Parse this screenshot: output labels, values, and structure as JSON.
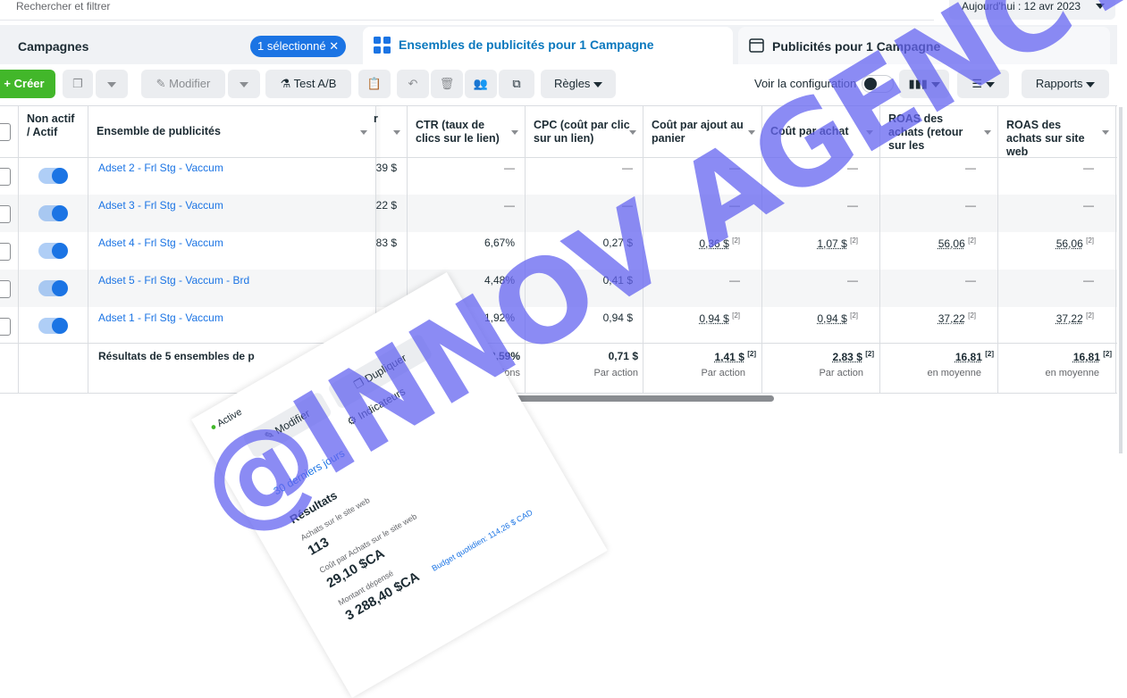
{
  "search": {
    "placeholder": "Rechercher et filtrer"
  },
  "date_range": "Aujourd'hui : 12 avr 2023",
  "tabs": {
    "campaigns": "Campagnes",
    "selected_badge": "1 sélectionné",
    "adsets": "Ensembles de publicités pour 1 Campagne",
    "ads": "Publicités pour 1 Campagne"
  },
  "toolbar": {
    "create": "Créer",
    "edit": "Modifier",
    "ab_test": "Test A/B",
    "rules": "Règles",
    "view_config": "Voir la configuration",
    "reports": "Rapports"
  },
  "columns": {
    "status": "Non actif / Actif",
    "adset": "Ensemble de publicités",
    "ctr": "CTR (taux de clics sur le lien)",
    "cpc": "CPC (coût par clic sur un lien)",
    "cost_cart": "Coût par ajout au panier",
    "cost_purchase": "Coût par achat",
    "roas": "ROAS des achats (retour sur les dépenses…",
    "roas_web": "ROAS des achats sur site web"
  },
  "rows": [
    {
      "name": "Adset 2 - Frl Stg - Vaccum",
      "hidden": "39 $",
      "ctr": "—",
      "cpc": "—",
      "cart": "—",
      "purchase": "—",
      "roas": "—",
      "roas_web": "—"
    },
    {
      "name": "Adset 3 - Frl Stg - Vaccum",
      "hidden": "22 $",
      "ctr": "—",
      "cpc": "—",
      "cart": "—",
      "purchase": "—",
      "roas": "—",
      "roas_web": "—"
    },
    {
      "name": "Adset 4 - Frl Stg - Vaccum",
      "hidden": "83 $",
      "ctr": "6,67%",
      "cpc": "0,27 $",
      "cart": "0,36 $",
      "purchase": "1,07 $",
      "roas": "56,06",
      "roas_web": "56,06"
    },
    {
      "name": "Adset 5 - Frl Stg - Vaccum - Brd",
      "hidden": "",
      "ctr": "4,48%",
      "cpc": "0,41 $",
      "cart": "—",
      "purchase": "—",
      "roas": "—",
      "roas_web": "—"
    },
    {
      "name": "Adset 1 - Frl Stg - Vaccum",
      "hidden": "",
      "ctr": "1,92%",
      "cpc": "0,94 $",
      "cart": "0,94 $",
      "purchase": "0,94 $",
      "roas": "37,22",
      "roas_web": "37,22"
    }
  ],
  "totals": {
    "label": "Résultats de 5 ensembles de p",
    "ctr": "2,59%",
    "ctr_sub": "Impressions",
    "cpc": "0,71 $",
    "cpc_sub": "Par action",
    "cart": "1,41 $",
    "cart_sub": "Par action",
    "purchase": "2,83 $",
    "purchase_sub": "Par action",
    "roas": "16,81",
    "roas_sub": "en moyenne",
    "roas_web": "16,81",
    "roas_web_sub": "en moyenne"
  },
  "footnote_mark": "[2]",
  "overlay_card": {
    "status": "Active",
    "edit": "Modifier",
    "duplicate": "Dupliquer",
    "indicators": "Indicateurs",
    "period": "30 derniers jours",
    "results_title": "Résultats",
    "purchases_label": "Achats sur le site web",
    "purchases_value": "113",
    "cost_label": "Coût par Achats sur le site web",
    "cost_value": "29,10 $CA",
    "spent_label": "Montant dépensé",
    "spent_value": "3 288,40 $CA",
    "budget_label": "Budget quotidien: 114,26 $ CAD"
  },
  "watermark": "@INNOV AGENCY",
  "colors": {
    "accent": "#1b74e4",
    "create": "#42b72a",
    "watermark": "#6464f0"
  }
}
